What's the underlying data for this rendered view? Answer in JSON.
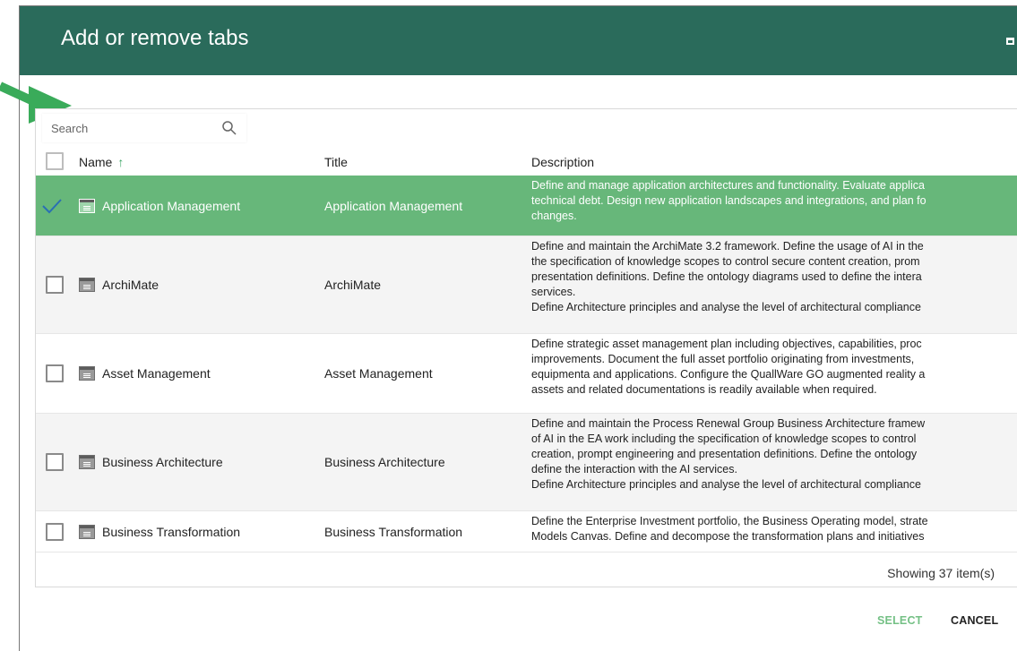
{
  "dialog": {
    "title": "Add or remove tabs",
    "accent_color": "#2a6b5b",
    "selected_row_color": "#67b77a"
  },
  "search": {
    "placeholder": "Search",
    "value": ""
  },
  "columns": {
    "name": "Name",
    "title": "Title",
    "description": "Description",
    "sort_icon": "↑"
  },
  "rows": [
    {
      "checked": true,
      "name": "Application Management",
      "title": "Application Management",
      "description": [
        "Define and manage application architectures and functionality. Evaluate applica",
        "technical debt. Design new application landscapes and integrations, and plan fo",
        "changes."
      ]
    },
    {
      "checked": false,
      "name": "ArchiMate",
      "title": "ArchiMate",
      "description": [
        "Define and maintain the ArchiMate 3.2 framework. Define the usage of AI in the",
        "the specification of knowledge scopes to control secure content creation, prom",
        "presentation definitions. Define the ontology diagrams used to define the intera",
        "services.",
        "Define Architecture principles and analyse the level of architectural compliance"
      ]
    },
    {
      "checked": false,
      "name": "Asset Management",
      "title": "Asset Management",
      "description": [
        "Define strategic asset management plan including objectives, capabilities, proc",
        "improvements. Document the full asset portfolio originating from investments,",
        "equipmenta and applications. Configure the QuallWare GO augmented reality a",
        "assets and related documentations is readily available when required."
      ]
    },
    {
      "checked": false,
      "name": "Business Architecture",
      "title": "Business Architecture",
      "description": [
        "Define and maintain the Process Renewal Group Business Architecture framew",
        "of AI in the EA work including the specification of knowledge scopes to control",
        "creation, prompt engineering and presentation definitions. Define the ontology",
        "define the interaction with the AI services.",
        "Define Architecture principles and analyse the level of architectural compliance"
      ]
    },
    {
      "checked": false,
      "name": "Business Transformation",
      "title": "Business Transformation",
      "description": [
        "Define the Enterprise Investment portfolio, the Business Operating model, strate",
        "Models Canvas. Define and decompose the transformation plans and initiatives"
      ]
    }
  ],
  "footer": {
    "count_text": "Showing 37 item(s)"
  },
  "buttons": {
    "select": "SELECT",
    "cancel": "CANCEL"
  }
}
